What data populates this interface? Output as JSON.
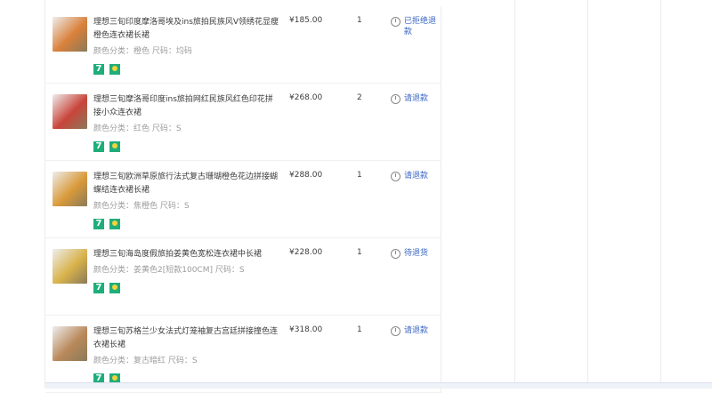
{
  "items": [
    {
      "title": "理想三旬印度摩洛哥埃及ins旅拍民族风V领绣花显瘦橙色连衣裙长裙",
      "sku": "颜色分类：橙色  尺码：均码",
      "price": "¥185.00",
      "qty": "1",
      "status": "已拒绝退款",
      "thumb_color": "#d9803a"
    },
    {
      "title": "理想三旬摩洛哥印度ins旅拍网红民族风红色印花拼接小众连衣裙",
      "sku": "颜色分类：红色  尺码：S",
      "price": "¥268.00",
      "qty": "2",
      "status": "请退款",
      "thumb_color": "#c8453a"
    },
    {
      "title": "理想三旬欧洲草原旅行法式复古珊瑚橙色花边拼接蝴蝶结连衣裙长裙",
      "sku": "颜色分类：焦橙色  尺码：S",
      "price": "¥288.00",
      "qty": "1",
      "status": "请退款",
      "thumb_color": "#d99a3a"
    },
    {
      "title": "理想三旬海岛度假旅拍姜黄色宽松连衣裙中长裙",
      "sku": "颜色分类：姜黄色2[短款100CM]  尺码：S",
      "price": "¥228.00",
      "qty": "1",
      "status": "待退货",
      "thumb_color": "#d8b24a"
    },
    {
      "title": "理想三旬苏格兰少女法式灯笼袖复古宫廷拼接撞色连衣裙长裙",
      "sku": "颜色分类：复古暗红  尺码：S",
      "price": "¥318.00",
      "qty": "1",
      "status": "请退款",
      "thumb_color": "#b9895a"
    }
  ],
  "badge_seven": "7"
}
